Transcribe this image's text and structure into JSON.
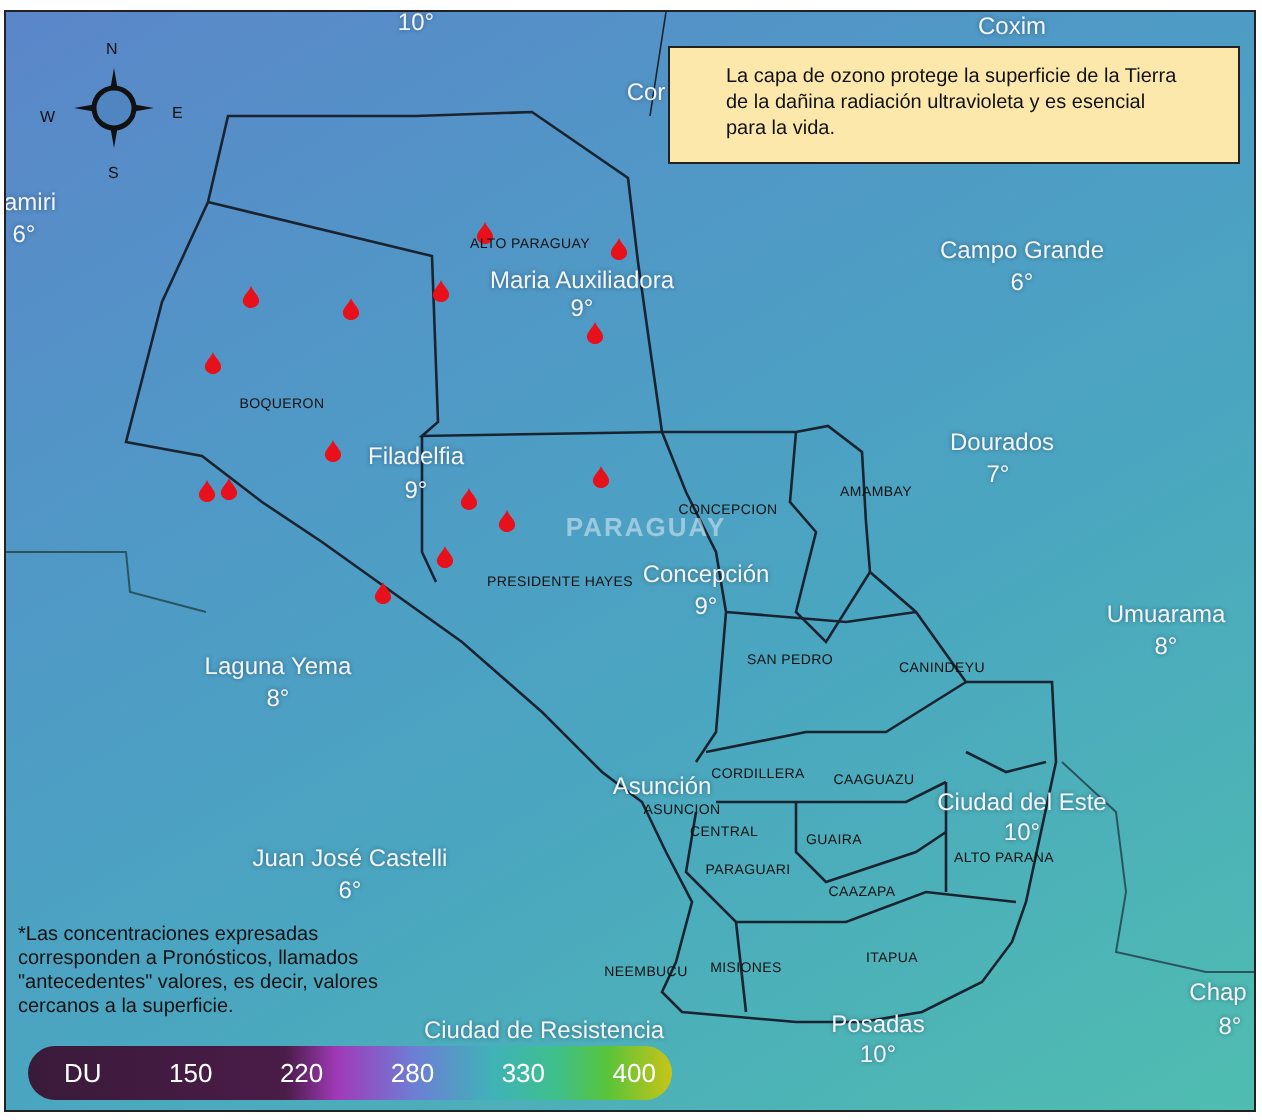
{
  "info_box": {
    "text": "La capa de ozono protege la superficie de la Tierra de la dañina radiación ultravioleta y es esencial para la vida."
  },
  "compass": [
    "N",
    "E",
    "S",
    "W"
  ],
  "country_label": "PARAGUAY",
  "cities": [
    {
      "temp": "10°"
    },
    {
      "name": "Coxim"
    },
    {
      "name": "Cor"
    },
    {
      "name": "amiri",
      "temp": "6°"
    },
    {
      "name": "Maria Auxiliadora",
      "temp": "9°"
    },
    {
      "name": "Campo Grande",
      "temp": "6°"
    },
    {
      "name": "Dourados",
      "temp": "7°"
    },
    {
      "name": "Filadelfia",
      "temp": "9°"
    },
    {
      "name": "Concepción",
      "temp": "9°"
    },
    {
      "name": "Umuarama",
      "temp": "8°"
    },
    {
      "name": "Laguna Yema",
      "temp": "8°"
    },
    {
      "name": "Asunción"
    },
    {
      "name": "Ciudad del Este",
      "temp": "10°"
    },
    {
      "name": "Juan José Castelli",
      "temp": "6°"
    },
    {
      "name": "Chap",
      "temp": "8°"
    },
    {
      "name": "Ciudad de Resistencia"
    },
    {
      "name": "Posadas",
      "temp": "10°"
    }
  ],
  "departments": [
    "ALTO PARAGUAY",
    "BOQUERON",
    "CONCEPCION",
    "AMAMBAY",
    "PRESIDENTE HAYES",
    "SAN PEDRO",
    "CANINDEYU",
    "CORDILLERA",
    "CAAGUAZU",
    "ASUNCION",
    "CENTRAL",
    "GUAIRA",
    "ALTO PARANA",
    "PARAGUARI",
    "CAAZAPA",
    "ITAPUA",
    "MISIONES",
    "NEEMBUCU"
  ],
  "footnote": "*Las concentraciones expresadas corresponden a Pronósticos, llamados \"antecedentes\" valores, es decir, valores cercanos a la superficie.",
  "legend": [
    "DU",
    "150",
    "220",
    "280",
    "330",
    "400"
  ]
}
